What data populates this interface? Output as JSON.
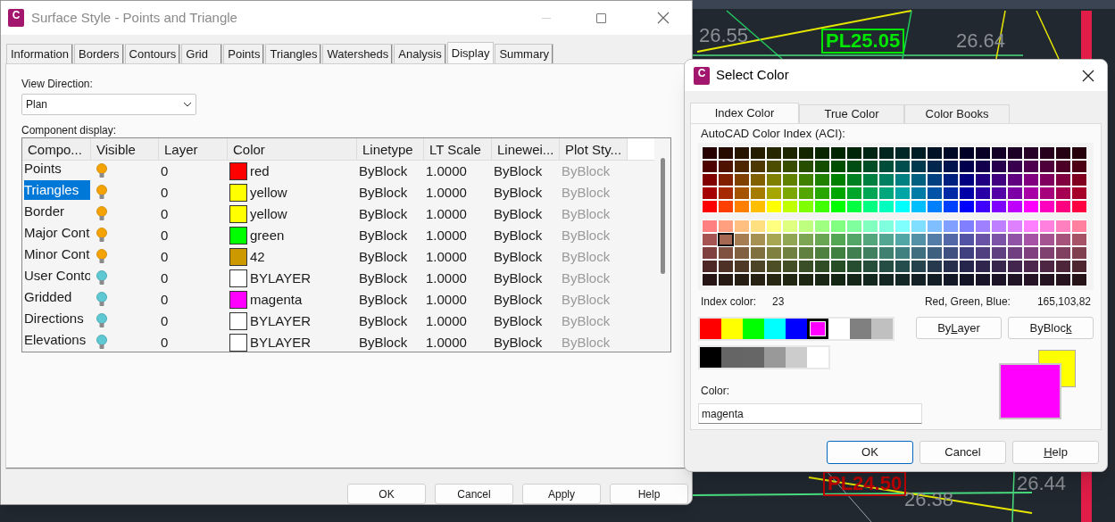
{
  "cad_labels": [
    {
      "text": "26.55",
      "boxed": false,
      "color": "#8a8f96"
    },
    {
      "text": "PL25.05",
      "boxed": true,
      "color": "#00e600"
    },
    {
      "text": "26.64",
      "boxed": false,
      "color": "#8a8f96"
    },
    {
      "text": "PL24.50",
      "boxed": true,
      "color": "#c00000"
    },
    {
      "text": "26.38",
      "boxed": false,
      "color": "#8a8f96"
    },
    {
      "text": "26.44",
      "boxed": false,
      "color": "#8a8f96"
    }
  ],
  "main_window": {
    "logo_text": "C",
    "title": "Surface Style - Points and Triangle",
    "tabs": [
      {
        "label": "Information",
        "selected": false
      },
      {
        "label": "Borders",
        "selected": false
      },
      {
        "label": "Contours",
        "selected": false
      },
      {
        "label": "Grid",
        "selected": false
      },
      {
        "label": "Points",
        "selected": false
      },
      {
        "label": "Triangles",
        "selected": false
      },
      {
        "label": "Watersheds",
        "selected": false
      },
      {
        "label": "Analysis",
        "selected": false
      },
      {
        "label": "Display",
        "selected": true
      },
      {
        "label": "Summary",
        "selected": false
      }
    ],
    "view_direction": {
      "label": "View Direction:",
      "value": "Plan"
    },
    "component_display": {
      "label": "Component display:",
      "columns": [
        "Compo...",
        "Visible",
        "Layer",
        "Color",
        "Linetype",
        "LT Scale",
        "Linewei...",
        "Plot Sty..."
      ],
      "rows": [
        {
          "name": "Points",
          "selected": false,
          "visible": true,
          "layer": "0",
          "color": "#ff0000",
          "color_name": "red",
          "linetype": "ByBlock",
          "lt_scale": "1.0000",
          "lineweight": "ByBlock",
          "plot_style": "ByBlock"
        },
        {
          "name": "Triangles",
          "selected": true,
          "visible": true,
          "layer": "0",
          "color": "#ffff00",
          "color_name": "yellow",
          "linetype": "ByBlock",
          "lt_scale": "1.0000",
          "lineweight": "ByBlock",
          "plot_style": "ByBlock"
        },
        {
          "name": "Border",
          "selected": false,
          "visible": true,
          "layer": "0",
          "color": "#ffff00",
          "color_name": "yellow",
          "linetype": "ByBlock",
          "lt_scale": "1.0000",
          "lineweight": "ByBlock",
          "plot_style": "ByBlock"
        },
        {
          "name": "Major Cont",
          "selected": false,
          "visible": true,
          "layer": "0",
          "color": "#00ff00",
          "color_name": "green",
          "linetype": "ByBlock",
          "lt_scale": "1.0000",
          "lineweight": "ByBlock",
          "plot_style": "ByBlock"
        },
        {
          "name": "Minor Cont",
          "selected": false,
          "visible": true,
          "layer": "0",
          "color": "#cc9900",
          "color_name": "42",
          "linetype": "ByBlock",
          "lt_scale": "1.0000",
          "lineweight": "ByBlock",
          "plot_style": "ByBlock"
        },
        {
          "name": "User Conto",
          "selected": false,
          "visible": false,
          "layer": "0",
          "color": "#ffffff",
          "color_name": "BYLAYER",
          "linetype": "ByBlock",
          "lt_scale": "1.0000",
          "lineweight": "ByBlock",
          "plot_style": "ByBlock"
        },
        {
          "name": "Gridded",
          "selected": false,
          "visible": false,
          "layer": "0",
          "color": "#ff00ff",
          "color_name": "magenta",
          "linetype": "ByBlock",
          "lt_scale": "1.0000",
          "lineweight": "ByBlock",
          "plot_style": "ByBlock"
        },
        {
          "name": "Directions",
          "selected": false,
          "visible": false,
          "layer": "0",
          "color": "#ffffff",
          "color_name": "BYLAYER",
          "linetype": "ByBlock",
          "lt_scale": "1.0000",
          "lineweight": "ByBlock",
          "plot_style": "ByBlock"
        },
        {
          "name": "Elevations",
          "selected": false,
          "visible": false,
          "layer": "0",
          "color": "#ffffff",
          "color_name": "BYLAYER",
          "linetype": "ByBlock",
          "lt_scale": "1.0000",
          "lineweight": "ByBlock",
          "plot_style": "ByBlock"
        }
      ]
    },
    "buttons": [
      "OK",
      "Cancel",
      "Apply",
      "Help"
    ]
  },
  "select_color": {
    "logo_text": "C",
    "title": "Select Color",
    "tabs": [
      {
        "label": "Index Color",
        "selected": true
      },
      {
        "label": "True Color",
        "selected": false
      },
      {
        "label": "Color Books",
        "selected": false
      }
    ],
    "aci_label": "AutoCAD Color Index (ACI):",
    "index_color": {
      "label": "Index color:",
      "value": "23"
    },
    "rgb": {
      "label": "Red, Green, Blue:",
      "value": "165,103,82"
    },
    "standard_colors": [
      {
        "color": "#ff0000",
        "selected": false
      },
      {
        "color": "#ffff00",
        "selected": false
      },
      {
        "color": "#00ff00",
        "selected": false
      },
      {
        "color": "#00ffff",
        "selected": false
      },
      {
        "color": "#0000ff",
        "selected": false
      },
      {
        "color": "#ff00ff",
        "selected": true
      },
      {
        "color": "#ffffff",
        "selected": false
      },
      {
        "color": "#808080",
        "selected": false
      },
      {
        "color": "#c0c0c0",
        "selected": false
      }
    ],
    "gray_colors": [
      {
        "color": "#000000",
        "selected": false
      },
      {
        "color": "#656565",
        "selected": false
      },
      {
        "color": "#666666",
        "selected": false
      },
      {
        "color": "#999999",
        "selected": false
      },
      {
        "color": "#cccccc",
        "selected": false
      },
      {
        "color": "#ffffff",
        "selected": false
      }
    ],
    "by_buttons": [
      {
        "before": "By",
        "key": "L",
        "after": "ayer"
      },
      {
        "before": "ByBloc",
        "key": "k"
      }
    ],
    "color_field": {
      "label": "Color:",
      "value": "magenta"
    },
    "preview": [
      {
        "kind": "old",
        "color": "#ffff00"
      },
      {
        "kind": "new",
        "color": "#ff00ff"
      }
    ],
    "buttons": [
      {
        "after": "OK",
        "default": true
      },
      {
        "after": "Cancel",
        "default": false
      },
      {
        "key": "H",
        "after": "elp",
        "default": false
      }
    ]
  }
}
